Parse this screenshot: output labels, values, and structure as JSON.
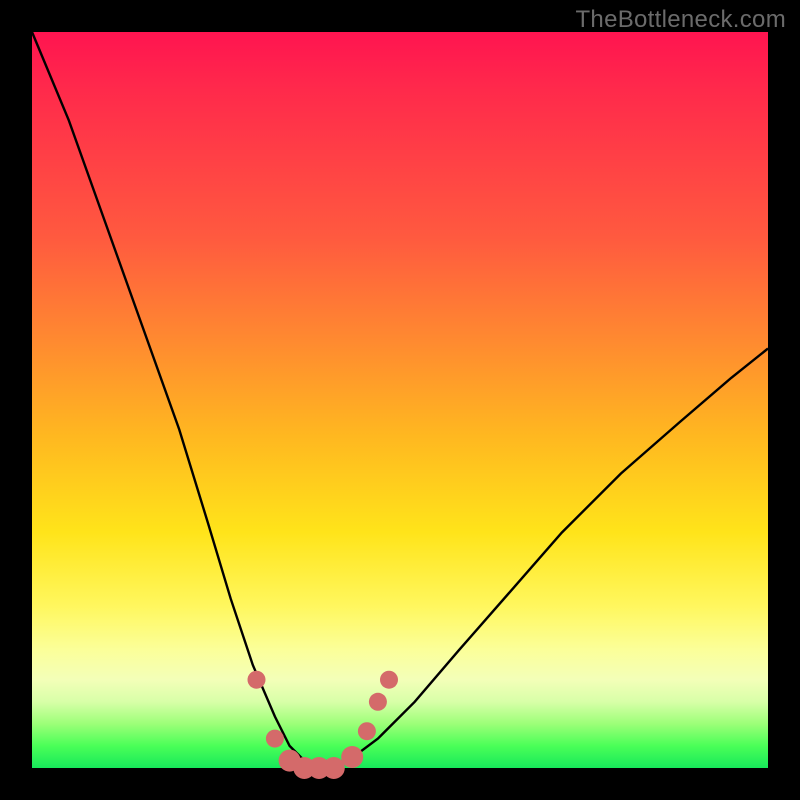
{
  "watermark": "TheBottleneck.com",
  "chart_data": {
    "type": "line",
    "title": "",
    "xlabel": "",
    "ylabel": "",
    "xlim": [
      0,
      100
    ],
    "ylim": [
      0,
      100
    ],
    "series": [
      {
        "name": "bottleneck-curve",
        "x": [
          0,
          5,
          10,
          15,
          20,
          24,
          27,
          30,
          33,
          35,
          37,
          39,
          41,
          43,
          47,
          52,
          58,
          65,
          72,
          80,
          88,
          95,
          100
        ],
        "values": [
          100,
          88,
          74,
          60,
          46,
          33,
          23,
          14,
          7,
          3,
          1,
          0,
          0,
          1,
          4,
          9,
          16,
          24,
          32,
          40,
          47,
          53,
          57
        ]
      }
    ],
    "markers": {
      "name": "highlight-points",
      "color": "#d46a6a",
      "x": [
        30.5,
        33,
        35,
        37,
        39,
        41,
        43.5,
        45.5,
        47,
        48.5
      ],
      "values": [
        12,
        4,
        1,
        0,
        0,
        0,
        1.5,
        5,
        9,
        12
      ]
    },
    "colors": {
      "curve": "#000000",
      "marker_fill": "#d46a6a",
      "background_top": "#ff1450",
      "background_bottom": "#17e85a",
      "frame": "#000000"
    }
  }
}
